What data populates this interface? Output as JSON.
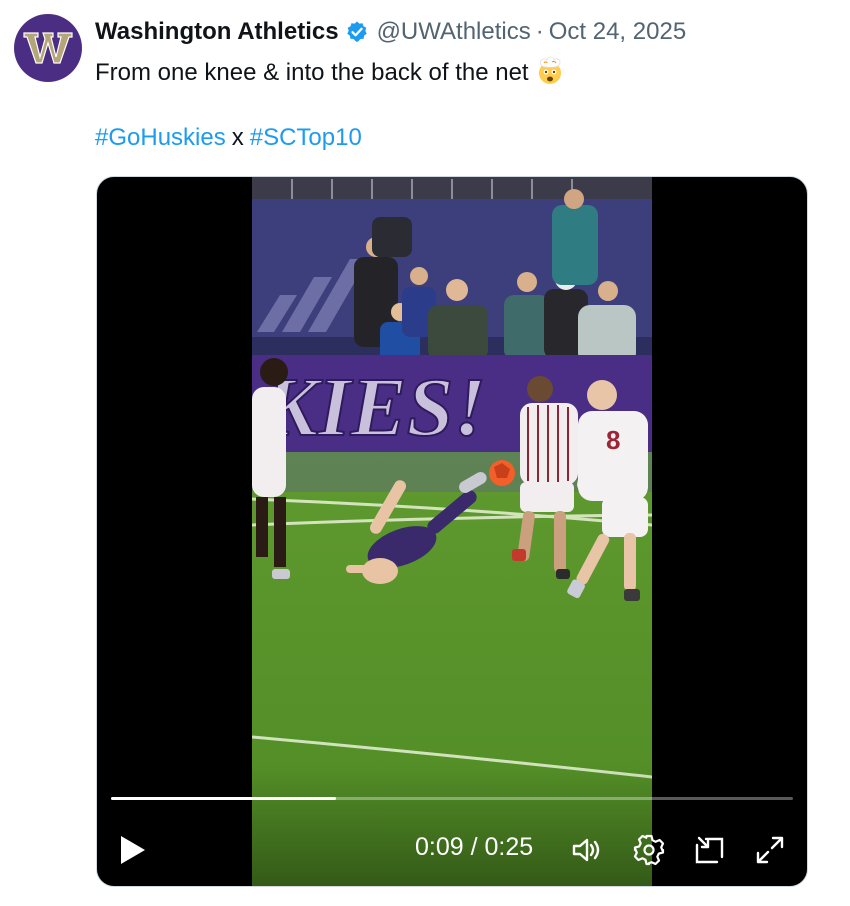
{
  "tweet": {
    "author": {
      "display_name": "Washington Athletics",
      "handle": "@UWAthletics",
      "avatar_letter": "W",
      "verified": true
    },
    "separator": "·",
    "date": "Oct 24, 2025",
    "text": "From one knee & into the back of the net",
    "emoji": "exploding-head-emoji",
    "hashtags": [
      "#GoHuskies",
      "#SCTop10"
    ],
    "hashtag_joiner": "x"
  },
  "video": {
    "current_time": "0:09",
    "duration": "0:25",
    "time_display": "0:09 / 0:25",
    "progress_fraction": 0.33,
    "scene_text": {
      "banner": "KIES!",
      "jersey_number": "8"
    },
    "controls": {
      "play": "play-icon",
      "volume": "volume-icon",
      "settings": "gear-icon",
      "pip": "picture-in-picture-icon",
      "fullscreen": "fullscreen-icon"
    }
  },
  "colors": {
    "accent": "#1d9bf0",
    "text": "#0f1419",
    "secondary_text": "#536471",
    "uw_purple": "#4b2e83",
    "uw_gold": "#b7a57a"
  }
}
